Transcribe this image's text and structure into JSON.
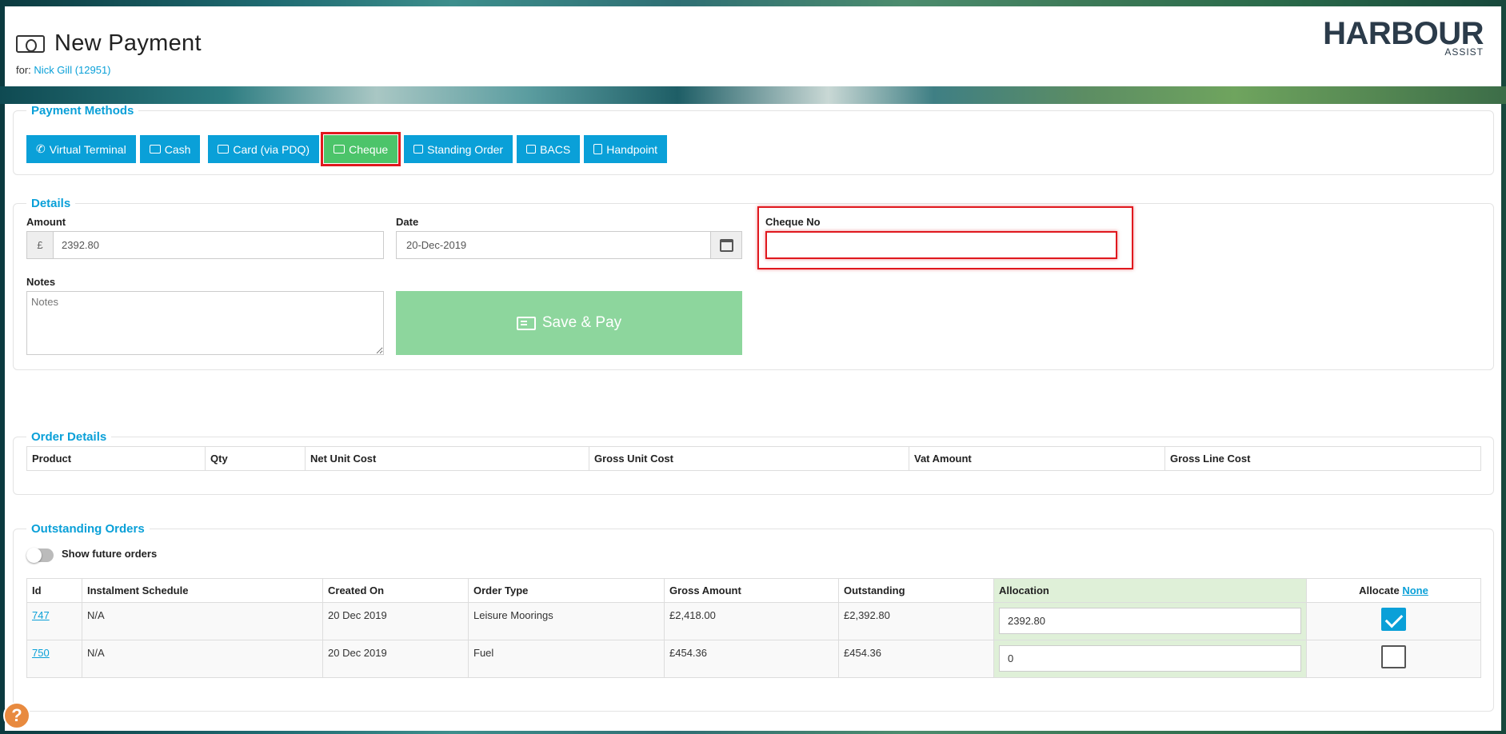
{
  "header": {
    "title": "New Payment",
    "for_prefix": "for:",
    "for_link": "Nick Gill (12951)",
    "logo_main": "HARBOUR",
    "logo_sub": "ASSIST"
  },
  "payment_methods": {
    "legend": "Payment Methods",
    "buttons": [
      "Virtual Terminal",
      "Cash",
      "Card (via PDQ)",
      "Cheque",
      "Standing Order",
      "BACS",
      "Handpoint"
    ],
    "selected": "Cheque"
  },
  "details": {
    "legend": "Details",
    "amount_label": "Amount",
    "currency": "£",
    "amount_value": "2392.80",
    "date_label": "Date",
    "date_value": "20-Dec-2019",
    "cheque_label": "Cheque No",
    "cheque_value": "",
    "notes_label": "Notes",
    "notes_placeholder": "Notes",
    "save_label": "Save & Pay"
  },
  "order_details": {
    "legend": "Order Details",
    "columns": [
      "Product",
      "Qty",
      "Net Unit Cost",
      "Gross Unit Cost",
      "Vat Amount",
      "Gross Line Cost"
    ]
  },
  "outstanding": {
    "legend": "Outstanding Orders",
    "toggle_label": "Show future orders",
    "columns": [
      "Id",
      "Instalment Schedule",
      "Created On",
      "Order Type",
      "Gross Amount",
      "Outstanding",
      "Allocation",
      "Allocate"
    ],
    "allocate_none": "None",
    "rows": [
      {
        "id": "747",
        "schedule": "N/A",
        "created": "20 Dec 2019",
        "type": "Leisure Moorings",
        "gross": "£2,418.00",
        "outstanding": "£2,392.80",
        "allocation": "2392.80",
        "checked": true
      },
      {
        "id": "750",
        "schedule": "N/A",
        "created": "20 Dec 2019",
        "type": "Fuel",
        "gross": "£454.36",
        "outstanding": "£454.36",
        "allocation": "0",
        "checked": false
      }
    ]
  },
  "colors": {
    "accent": "#0aa0d8",
    "selected_method": "#4cc46a",
    "highlight": "#e0181e",
    "save_button": "#8dd69d",
    "allocation_bg": "#dff0d8"
  },
  "icons": [
    "money-icon",
    "phone-icon",
    "cash-icon",
    "card-icon",
    "cheque-icon",
    "calendar-icon",
    "calculator-icon",
    "help-icon"
  ]
}
